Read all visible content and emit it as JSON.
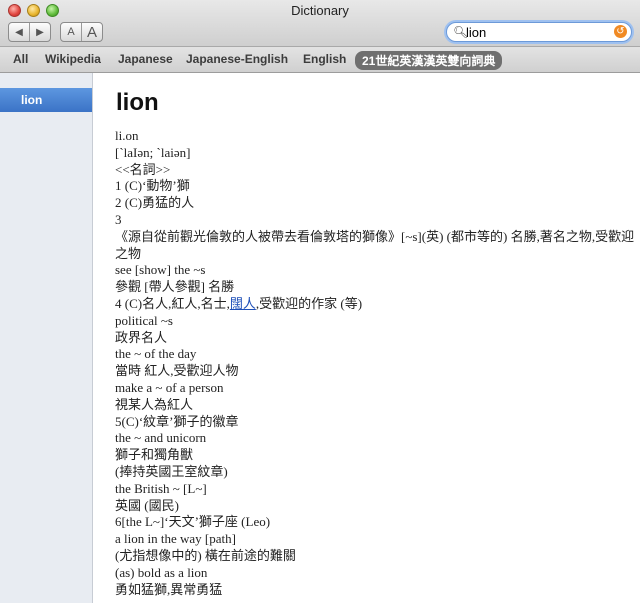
{
  "window": {
    "title": "Dictionary"
  },
  "toolbar": {
    "back_glyph": "◀",
    "forward_glyph": "▶",
    "font_small": "A",
    "font_large": "A"
  },
  "search": {
    "value": "lion",
    "clear_glyph": "↺"
  },
  "scopes": [
    "All",
    "Wikipedia",
    "Japanese",
    "Japanese-English",
    "English",
    "21世紀英漢漢英雙向詞典"
  ],
  "active_scope": "21世紀英漢漢英雙向詞典",
  "sidebar": {
    "items": [
      "lion"
    ]
  },
  "entry": {
    "headword": "lion",
    "lines": [
      "li.on",
      "[ˋlaIən; ˋlaiən]",
      "<<名詞>>",
      "1 (C)‘動物’獅",
      "2 (C)勇猛的人",
      "3",
      "《源自從前觀光倫敦的人被帶去看倫敦塔的獅像》[~s](英) (都市等的) 名勝,著名之物,受歡迎之物",
      "see [show] the ~s",
      "參觀 [帶人參觀] 名勝",
      "4 (C)名人,紅人,名士,",
      "political ~s",
      "政界名人",
      "the ~ of the day",
      "當時 紅人,受歡迎人物",
      "make a ~ of a person",
      "視某人為紅人",
      "5(C)‘紋章’獅子的徽章",
      "the ~ and unicorn",
      "獅子和獨角獸",
      "(捧持英國王室紋章)",
      "the British ~ [L~]",
      "英國 (國民)",
      "6[the L~]‘天文’獅子座 (Leo)",
      "a lion in the way [path]",
      "(尤指想像中的) 橫在前途的難關",
      "(as) bold as a lion",
      "勇如猛獅,異常勇猛"
    ],
    "line4_link": "闊人",
    "line4_tail": ",受歡迎的作家 (等)"
  }
}
